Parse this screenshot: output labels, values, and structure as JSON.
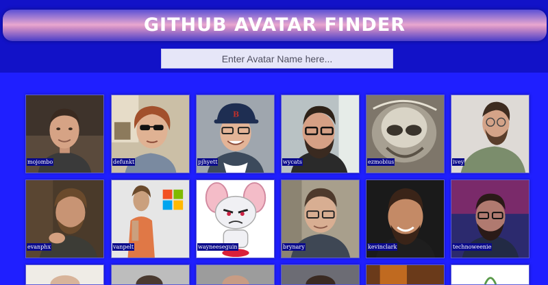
{
  "header": {
    "title": "GITHUB AVATAR FINDER",
    "search_placeholder": "Enter Avatar Name here..."
  },
  "avatars": [
    {
      "login": "mojombo"
    },
    {
      "login": "defunkt"
    },
    {
      "login": "pjhyett"
    },
    {
      "login": "wycats"
    },
    {
      "login": "ezmobius"
    },
    {
      "login": "ivey"
    },
    {
      "login": "evanphx"
    },
    {
      "login": "vanpelt"
    },
    {
      "login": "wayneeseguin"
    },
    {
      "login": "brynary"
    },
    {
      "login": "kevinclark"
    },
    {
      "login": "technoweenie"
    }
  ],
  "colors": {
    "page_background": "#1f1fff",
    "header_background": "#1212c8",
    "label_background": "#0a0a8a"
  }
}
